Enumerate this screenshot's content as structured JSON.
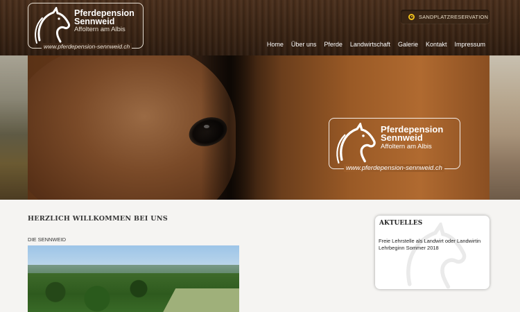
{
  "header": {
    "logo": {
      "line1": "Pferdepension",
      "line2": "Sennweid",
      "line3": "Affoltern am Albis",
      "url": "www.pferdepension-sennweid.ch"
    },
    "reservation_button": {
      "label": "SANDPLATZRESERVATION",
      "icon": "target-icon",
      "icon_color": "#f2c21b"
    },
    "nav": [
      "Home",
      "Über uns",
      "Pferde",
      "Landwirtschaft",
      "Galerie",
      "Kontakt",
      "Impressum"
    ]
  },
  "hero": {
    "logo": {
      "line1": "Pferdepension",
      "line2": "Sennweid",
      "line3": "Affoltern am Albis",
      "url": "www.pferdepension-sennweid.ch"
    }
  },
  "main": {
    "heading": "HERZLICH WILLKOMMEN BEI UNS",
    "section_label": "DIE SENNWEID"
  },
  "sidebar": {
    "aktuelles": {
      "title": "AKTUELLES",
      "text": "Freie Lehrstelle als Landwirt oder Landwirtin Lehrbeginn Sommer 2018"
    }
  },
  "colors": {
    "header_brown": "#3a2414",
    "accent_yellow": "#f2c21b"
  }
}
